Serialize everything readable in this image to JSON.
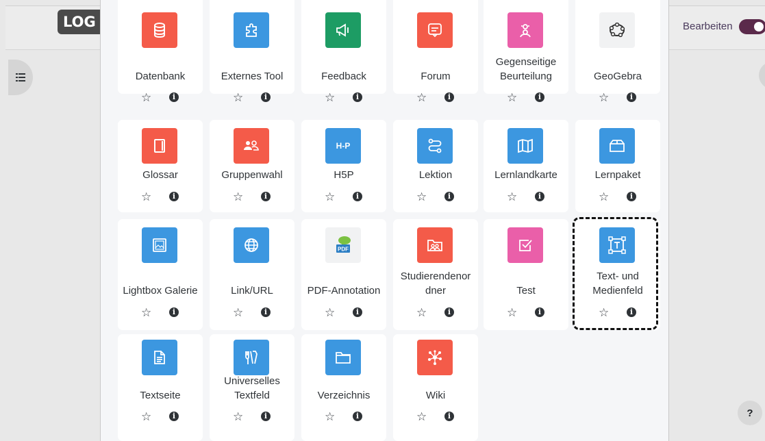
{
  "header": {
    "logo_text": "LOG",
    "edit_label": "Bearbeiten",
    "edit_enabled": true
  },
  "help": {
    "label": "?"
  },
  "colors": {
    "communication": "#ff5c49",
    "administration": "#3995e4",
    "collaboration": "#1a9a65",
    "assessment": "#e95ca7",
    "gray": "#f0f0f1"
  },
  "activities": [
    {
      "label": "Datenbank",
      "color": "#f45b49",
      "icon": "database-icon"
    },
    {
      "label": "Externes Tool",
      "color": "#3c97e0",
      "icon": "puzzle-icon"
    },
    {
      "label": "Feedback",
      "color": "#1d9c64",
      "icon": "megaphone-icon"
    },
    {
      "label": "Forum",
      "color": "#f45b49",
      "icon": "message-icon"
    },
    {
      "label": "Gegenseitige Beurteilung",
      "color": "#ea5fa9",
      "icon": "peer-review-icon"
    },
    {
      "label": "GeoGebra",
      "color": "#f1f2f3",
      "icon": "geogebra-icon"
    },
    {
      "label": "Glossar",
      "color": "#f45b49",
      "icon": "glossary-book-icon"
    },
    {
      "label": "Gruppenwahl",
      "color": "#f45b49",
      "icon": "group-icon"
    },
    {
      "label": "H5P",
      "color": "#3c97e0",
      "icon": "h5p-icon"
    },
    {
      "label": "Lektion",
      "color": "#3c97e0",
      "icon": "lesson-path-icon"
    },
    {
      "label": "Lernlandkarte",
      "color": "#3c97e0",
      "icon": "map-icon"
    },
    {
      "label": "Lernpaket",
      "color": "#3c97e0",
      "icon": "package-icon"
    },
    {
      "label": "Lightbox Galerie",
      "color": "#3c97e0",
      "icon": "gallery-icon"
    },
    {
      "label": "Link/URL",
      "color": "#3c97e0",
      "icon": "globe-icon"
    },
    {
      "label": "PDF-Annotation",
      "color": "#f1f2f3",
      "icon": "pdf-annotation-icon"
    },
    {
      "label": "Studierendenordner",
      "color": "#f45b49",
      "icon": "student-folder-icon"
    },
    {
      "label": "Test",
      "color": "#ea5fa9",
      "icon": "checkbox-icon"
    },
    {
      "label": "Text- und Medienfeld",
      "color": "#3c97e0",
      "icon": "text-frame-icon"
    },
    {
      "label": "Textseite",
      "color": "#3c97e0",
      "icon": "document-icon"
    },
    {
      "label": "Universelles Textfeld",
      "color": "#3c97e0",
      "icon": "tools-icon"
    },
    {
      "label": "Verzeichnis",
      "color": "#3c97e0",
      "icon": "folder-icon"
    },
    {
      "label": "Wiki",
      "color": "#f45b49",
      "icon": "wiki-network-icon"
    }
  ],
  "labels_display": {
    "gegenseitige": [
      "Gegenseitige",
      "Beurteilung"
    ],
    "studierenden": [
      "Studierendenor",
      "dner"
    ],
    "textmedien": [
      "Text- und",
      "Medienfeld"
    ],
    "universelles": [
      "Universelles",
      "Textfeld"
    ]
  },
  "actions": {
    "star": "☆",
    "info": "i"
  }
}
